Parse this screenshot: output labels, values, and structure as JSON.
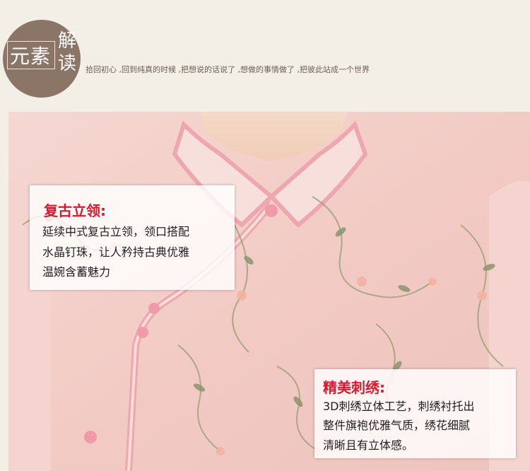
{
  "header": {
    "badge_left": "元素",
    "badge_right_1": "解",
    "badge_right_2": "读",
    "tagline": "拾回初心 ,回到纯真的时候 ,把想说的话说了 ,想做的事情做了 ,把彼此站成一个世界"
  },
  "callouts": [
    {
      "title": "复古立领:",
      "lines": [
        "延续中式复古立领，领口搭配",
        "水晶钉珠，让人矜持古典优雅",
        "温婉含蓄魅力"
      ]
    },
    {
      "title": "精美刺绣:",
      "lines": [
        "3D刺绣立体工艺，刺绣衬托出",
        "整件旗袍优雅气质，绣花细腻",
        "清晰且有立体感。"
      ]
    }
  ],
  "colors": {
    "background": "#f3efe6",
    "badge": "#8a7567",
    "title_red": "#d8182f",
    "fabric_pink": "#f3cfc9"
  }
}
